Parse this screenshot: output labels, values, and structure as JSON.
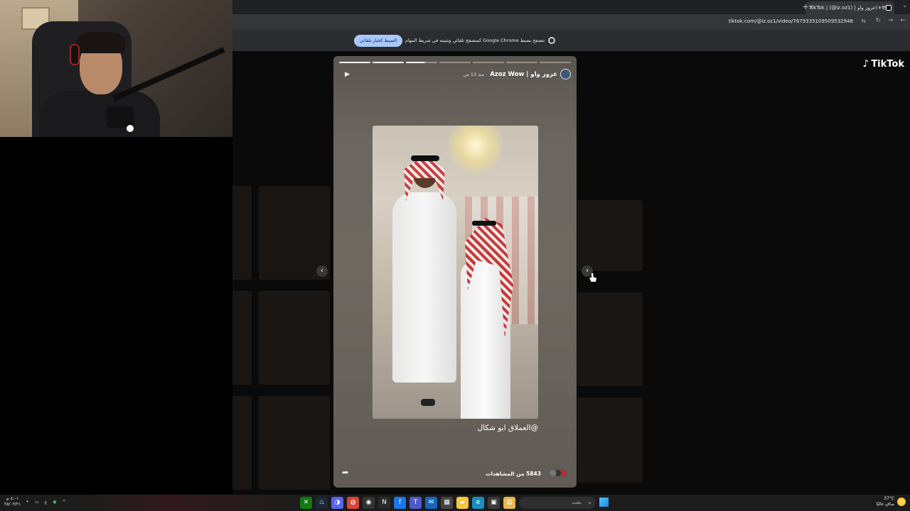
{
  "browser": {
    "tab_title": "(99+)عزوز واو | TikTok | (@iz.oz1)",
    "tab_close": "×",
    "new_tab": "+",
    "tab_menu": "⌄",
    "url": "tiktok.com/@iz.oz1/video/7679335109509532948",
    "nav_back": "←",
    "nav_forward": "→",
    "nav_reload": "↻"
  },
  "infobar": {
    "message": "تتصفح بضبط Google Chrome كمتصفح تلقائي وتثبيته في شريط المهام",
    "button_label": "الضبط كخيار تلقائي"
  },
  "tiktok": {
    "logo_text": "TikTok",
    "logo_glyph": "♪"
  },
  "story": {
    "author": "عزوز واو | Azoz Wow",
    "time": "· منذ 13 س",
    "caption": "@العملاق ابو شكال",
    "views": "5843 من المشاهدات",
    "progress_segments": [
      {
        "state": "done"
      },
      {
        "state": "done"
      },
      {
        "state": "active"
      },
      {
        "state": "pending"
      },
      {
        "state": "pending"
      },
      {
        "state": "pending"
      },
      {
        "state": "pending"
      }
    ],
    "play_glyph": "▶",
    "share_glyph": "➦",
    "prev_glyph": "‹",
    "next_glyph": "›"
  },
  "taskbar": {
    "search_placeholder": "بحث",
    "search_glyph": "⌕",
    "clock_time": "٨:٠١ م",
    "clock_date": "٢٥/٠٣/٢١",
    "weather_temp": "37°C",
    "weather_desc": "صافٍ غالبًا",
    "lang": "ع",
    "tray_chevron": "^",
    "apps": [
      {
        "name": "start",
        "glyph": "",
        "color": "#1e88e5"
      },
      {
        "name": "file-explorer",
        "glyph": "▤",
        "color": "#e8b84a"
      },
      {
        "name": "store",
        "glyph": "▣",
        "color": "#3a3a3a"
      },
      {
        "name": "edge",
        "glyph": "e",
        "color": "#1a8fbf"
      },
      {
        "name": "explorer",
        "glyph": "▰",
        "color": "#f5c542"
      },
      {
        "name": "calendar",
        "glyph": "▦",
        "color": "#444"
      },
      {
        "name": "mail",
        "glyph": "✉",
        "color": "#1565c0"
      },
      {
        "name": "teams",
        "glyph": "T",
        "color": "#5059c9"
      },
      {
        "name": "facebook",
        "glyph": "f",
        "color": "#1877f2"
      },
      {
        "name": "nvidia",
        "glyph": "N",
        "color": "#2a2a2a"
      },
      {
        "name": "obs",
        "glyph": "◉",
        "color": "#333"
      },
      {
        "name": "chrome",
        "glyph": "◍",
        "color": "#db4437"
      },
      {
        "name": "discord",
        "glyph": "◑",
        "color": "#5865f2"
      },
      {
        "name": "steam",
        "glyph": "♨",
        "color": "#1b2838"
      },
      {
        "name": "xbox",
        "glyph": "✕",
        "color": "#107c10"
      }
    ]
  },
  "colors": {
    "accent": "#a8c7fa",
    "page_bg": "#0a0a0a",
    "taskbar_bg": "#1c1c1c"
  }
}
